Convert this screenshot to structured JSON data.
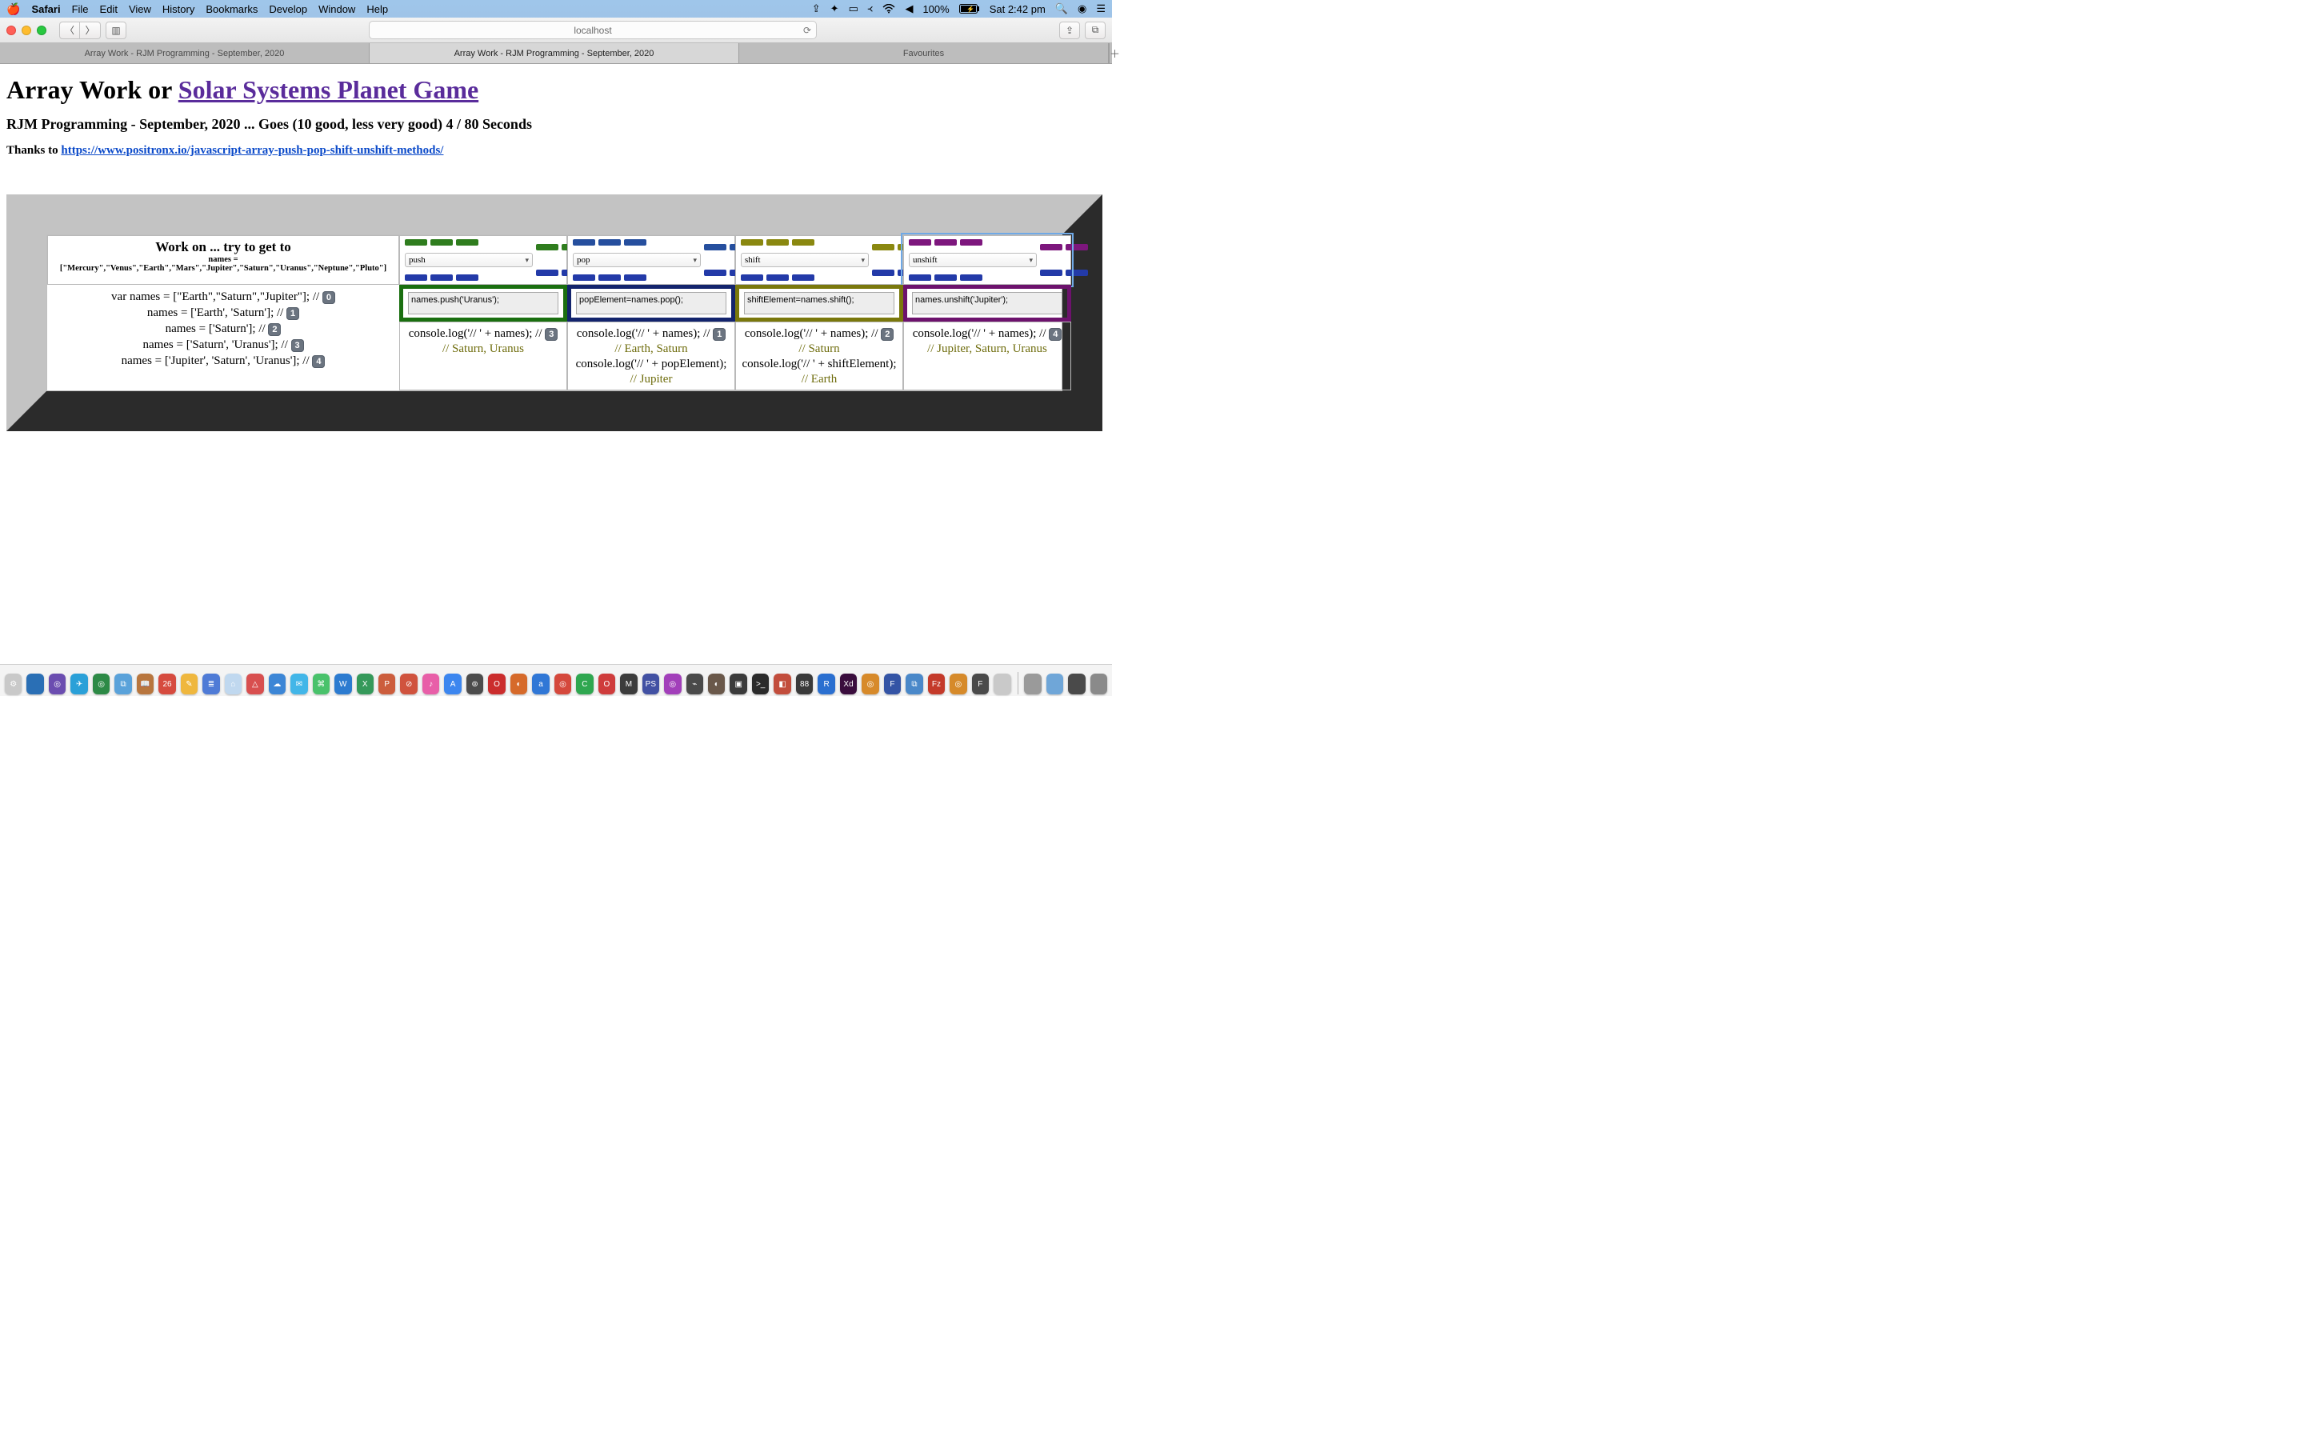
{
  "menubar": {
    "app": "Safari",
    "items": [
      "File",
      "Edit",
      "View",
      "History",
      "Bookmarks",
      "Develop",
      "Window",
      "Help"
    ],
    "battery": "100%",
    "clock": "Sat 2:42 pm"
  },
  "toolbar": {
    "url": "localhost"
  },
  "tabs": {
    "items": [
      {
        "label": "Array Work - RJM Programming - September, 2020",
        "active": false
      },
      {
        "label": "Array Work - RJM Programming - September, 2020",
        "active": true
      },
      {
        "label": "Favourites",
        "active": false
      }
    ]
  },
  "page": {
    "title_prefix": "Array Work or ",
    "title_link": "Solar Systems Planet Game",
    "subtitle": "RJM Programming - September, 2020 ... Goes (10 good, less very good) 4 / 80 Seconds",
    "thanks_prefix": "Thanks to ",
    "thanks_link": "https://www.positronx.io/javascript-array-push-pop-shift-unshift-methods/"
  },
  "workcell": {
    "title": "Work on ... try to get to",
    "names_line": "names = [\"Mercury\",\"Venus\",\"Earth\",\"Mars\",\"Jupiter\",\"Saturn\",\"Uranus\",\"Neptune\",\"Pluto\"]"
  },
  "ops": {
    "push": {
      "select": "push",
      "textarea": "names.push('Uranus');",
      "console": "console.log('// ' + names); //",
      "badge": "3",
      "result": "// Saturn, Uranus"
    },
    "pop": {
      "select": "pop",
      "textarea": "popElement=names.pop();",
      "console": "console.log('// ' + names); //",
      "badge": "1",
      "result": "// Earth, Saturn",
      "extra": "console.log('// ' + popElement);",
      "extra2": "// Jupiter"
    },
    "shift": {
      "select": "shift",
      "textarea": "shiftElement=names.shift();",
      "console": "console.log('// ' + names); //",
      "badge": "2",
      "result": "// Saturn",
      "extra": "console.log('// ' + shiftElement);",
      "extra2": "// Earth"
    },
    "unshift": {
      "select": "unshift",
      "textarea": "names.unshift('Jupiter');",
      "console": "console.log('// ' + names); //",
      "badge": "4",
      "result": "// Jupiter, Saturn, Uranus"
    }
  },
  "history": [
    {
      "code": "var names = [\"Earth\",\"Saturn\",\"Jupiter\"]; //",
      "n": "0"
    },
    {
      "code": "names = ['Earth', 'Saturn']; //",
      "n": "1"
    },
    {
      "code": "names = ['Saturn']; //",
      "n": "2"
    },
    {
      "code": "names = ['Saturn', 'Uranus']; //",
      "n": "3"
    },
    {
      "code": "names = ['Jupiter', 'Saturn', 'Uranus']; //",
      "n": "4"
    }
  ],
  "dock": [
    {
      "bg": "#c9c9c9",
      "t": "⚙︎"
    },
    {
      "bg": "#2a6fb5",
      "t": ""
    },
    {
      "bg": "#6b4db0",
      "t": "◎"
    },
    {
      "bg": "#2aa0d8",
      "t": "✈"
    },
    {
      "bg": "#2d8a46",
      "t": "◎"
    },
    {
      "bg": "#5aa2da",
      "t": "⧉"
    },
    {
      "bg": "#b8763e",
      "t": "📖"
    },
    {
      "bg": "#d64b3f",
      "t": "26"
    },
    {
      "bg": "#efb73e",
      "t": "✎"
    },
    {
      "bg": "#4f7bd6",
      "t": "≣"
    },
    {
      "bg": "#c0d8ef",
      "t": "⌂"
    },
    {
      "bg": "#d84f4f",
      "t": "△"
    },
    {
      "bg": "#3c86d6",
      "t": "☁"
    },
    {
      "bg": "#42b6e8",
      "t": "✉"
    },
    {
      "bg": "#49c26b",
      "t": "⌘"
    },
    {
      "bg": "#2c7bd0",
      "t": "W"
    },
    {
      "bg": "#35995a",
      "t": "X"
    },
    {
      "bg": "#cc5d3d",
      "t": "P"
    },
    {
      "bg": "#d0533e",
      "t": "⊘"
    },
    {
      "bg": "#e85fa8",
      "t": "♪"
    },
    {
      "bg": "#3c86ef",
      "t": "A"
    },
    {
      "bg": "#4c4c4c",
      "t": "⊚"
    },
    {
      "bg": "#cb2d2d",
      "t": "O"
    },
    {
      "bg": "#d66a2a",
      "t": "◐"
    },
    {
      "bg": "#3077d6",
      "t": "a"
    },
    {
      "bg": "#d5483c",
      "t": "◎"
    },
    {
      "bg": "#2fa750",
      "t": "C"
    },
    {
      "bg": "#cf3c3c",
      "t": "O"
    },
    {
      "bg": "#3c3c3c",
      "t": "M"
    },
    {
      "bg": "#4251a3",
      "t": "PS"
    },
    {
      "bg": "#a23fba",
      "t": "◎"
    },
    {
      "bg": "#4a4a4a",
      "t": "⌁"
    },
    {
      "bg": "#6a584a",
      "t": "◐"
    },
    {
      "bg": "#3b3b3b",
      "t": "▣"
    },
    {
      "bg": "#2b2b2b",
      "t": ">_"
    },
    {
      "bg": "#c24d3c",
      "t": "◧"
    },
    {
      "bg": "#3a3a3a",
      "t": "88"
    },
    {
      "bg": "#2a6fd0",
      "t": "R"
    },
    {
      "bg": "#3a0d3d",
      "t": "Xd"
    },
    {
      "bg": "#d78a2a",
      "t": "◎"
    },
    {
      "bg": "#3454a5",
      "t": "F"
    },
    {
      "bg": "#4a88c9",
      "t": "⧉"
    },
    {
      "bg": "#c43a2a",
      "t": "Fz"
    },
    {
      "bg": "#d68a2a",
      "t": "◎"
    },
    {
      "bg": "#4a4a4a",
      "t": "F"
    },
    {
      "bg": "#c9c9c9",
      "t": ""
    }
  ]
}
